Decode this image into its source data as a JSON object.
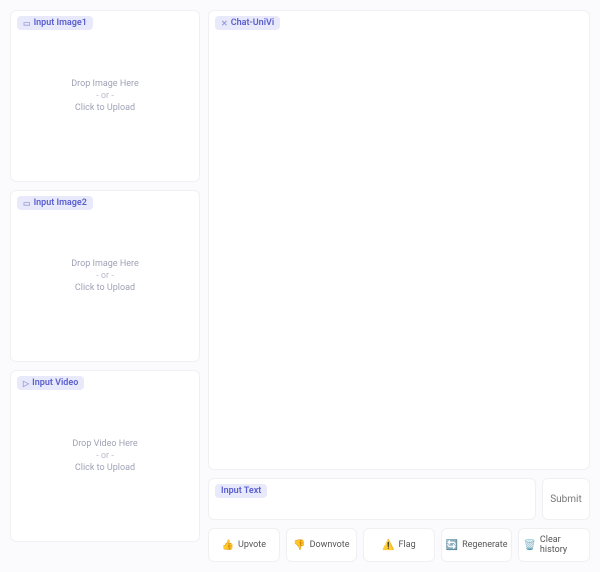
{
  "left": {
    "image1": {
      "label": "Input Image1",
      "drop1": "Drop Image Here",
      "drop2": "- or -",
      "drop3": "Click to Upload"
    },
    "image2": {
      "label": "Input Image2",
      "drop1": "Drop Image Here",
      "drop2": "- or -",
      "drop3": "Click to Upload"
    },
    "video": {
      "label": "Input Video",
      "drop1": "Drop Video Here",
      "drop2": "- or -",
      "drop3": "Click to Upload"
    }
  },
  "chat": {
    "label": "Chat-UniVi"
  },
  "textbox": {
    "label": "Input Text"
  },
  "submit": {
    "label": "Submit"
  },
  "buttons": {
    "upvote": {
      "icon": "👍",
      "label": "Upvote"
    },
    "downvote": {
      "icon": "👎",
      "label": "Downvote"
    },
    "flag": {
      "icon": "⚠️",
      "label": "Flag"
    },
    "regen": {
      "icon": "🔄",
      "label": "Regenerate"
    },
    "clear": {
      "icon": "🗑️",
      "label": "Clear history"
    }
  }
}
